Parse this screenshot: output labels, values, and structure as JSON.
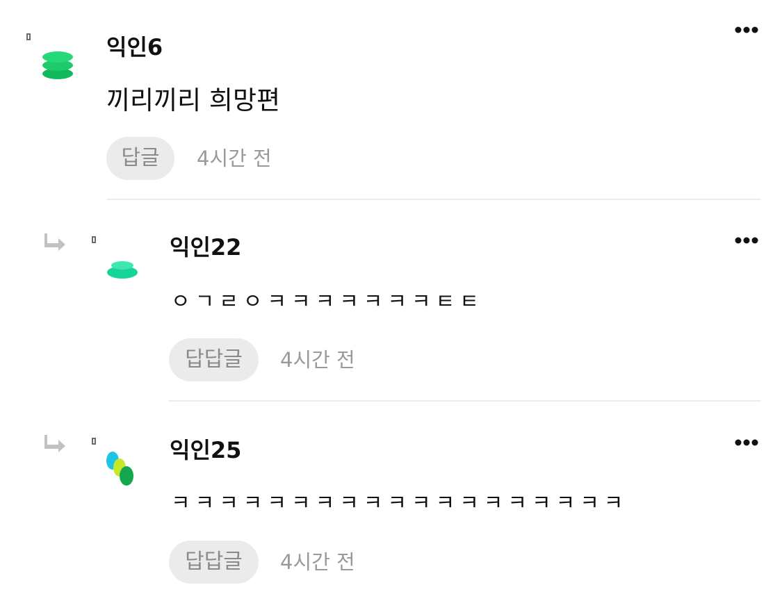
{
  "comments": [
    {
      "nickname": "익인6",
      "text": "끼리끼리 희망편",
      "reply_label": "답글",
      "time": "4시간 전",
      "avatar_icon": "green-stack-icon",
      "is_reply": false
    },
    {
      "nickname": "익인22",
      "text": "ㅇㄱㄹㅇㅋㅋㅋㅋㅋㅋㅋㅌㅌ",
      "reply_label": "답답글",
      "time": "4시간 전",
      "avatar_icon": "teal-disc-icon",
      "is_reply": true
    },
    {
      "nickname": "익인25",
      "text": "ㅋㅋㅋㅋㅋㅋㅋㅋㅋㅋㅋㅋㅋㅋㅋㅋㅋㅋㅋ",
      "reply_label": "답답글",
      "time": "4시간 전",
      "avatar_icon": "tricolor-dots-icon",
      "is_reply": true
    }
  ],
  "colors": {
    "avatar_green": "#1ecb6b",
    "avatar_teal": "#17d49a",
    "avatar_cyan": "#1cc4e6",
    "avatar_lime": "#c6e82a",
    "avatar_dark_green": "#14a84e",
    "reply_button_bg": "#ebebeb",
    "meta_text": "#9a9a9a"
  }
}
